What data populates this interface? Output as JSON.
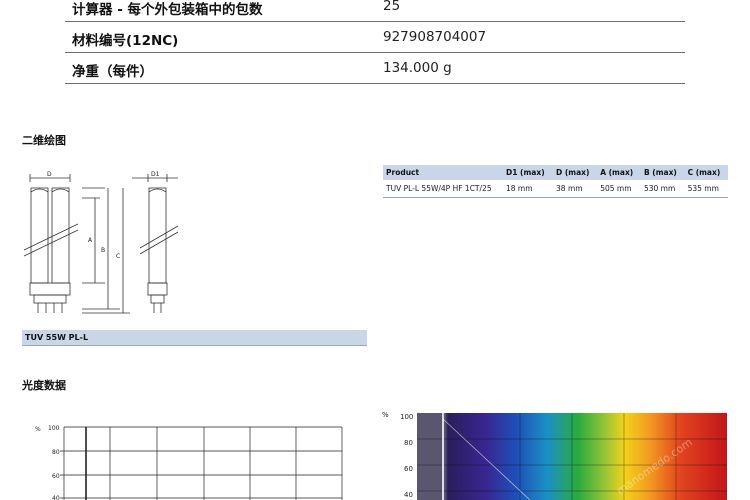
{
  "specs": [
    {
      "label": "计算器 - 每个外包装箱中的包数",
      "value": "25"
    },
    {
      "label": "材料编号(12NC)",
      "value": "927908704007"
    },
    {
      "label": "净重（每件）",
      "value": "134.000 g"
    }
  ],
  "drawing": {
    "title": "二维绘图",
    "labels": {
      "d": "D",
      "d1": "D1",
      "a": "A",
      "b": "B",
      "c": "C"
    },
    "caption": "TUV 55W PL-L"
  },
  "dimensions_table": {
    "headers": [
      "Product",
      "D1 (max)",
      "D (max)",
      "A (max)",
      "B (max)",
      "C (max)"
    ],
    "rows": [
      [
        "TUV PL-L 55W/4P HF 1CT/25",
        "18 mm",
        "38 mm",
        "505 mm",
        "530 mm",
        "535 mm"
      ]
    ]
  },
  "photometric": {
    "title": "光度数据",
    "left_chart": {
      "unit": "%",
      "ticks": [
        "100",
        "80",
        "60",
        "40"
      ]
    },
    "right_chart": {
      "unit": "%",
      "ticks": [
        "100",
        "80",
        "60",
        "40"
      ]
    },
    "watermark": "manomedo.com"
  }
}
